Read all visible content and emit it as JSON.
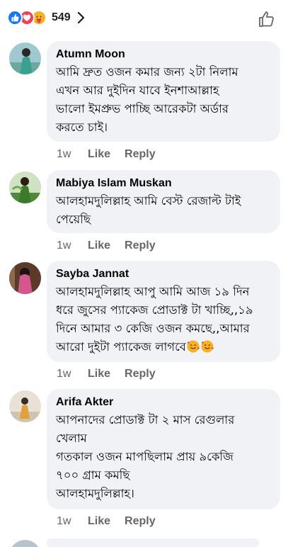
{
  "reactions": {
    "icons": [
      "like-icon",
      "love-icon",
      "care-icon"
    ],
    "count": "549",
    "colors": {
      "like": "#1877f2",
      "love": "#f33e58",
      "care": "#f7b125"
    }
  },
  "comments": [
    {
      "author": "Atumn Moon",
      "text": "আমি দ্রুত ওজন কমার জন্য ২টা নিলাম\nএখন আর দুইদিন যাবে ইনশাআল্লাহ\nভালো ইমপ্রুভ পাচ্ছি আরেকটা অর্ডার\nকরতে চাই।",
      "time": "1w",
      "like_label": "Like",
      "reply_label": "Reply"
    },
    {
      "author": "Mabiya Islam Muskan",
      "text": "আলহামদুলিল্লাহ আমি বেস্ট রেজাল্ট টাই\nপেয়েছি",
      "time": "1w",
      "like_label": "Like",
      "reply_label": "Reply"
    },
    {
      "author": "Sayba Jannat",
      "text": "আলহামদুলিল্লাহ আপু আমি আজ ১৯ দিন\nধরে জুসের প্যাকেজ প্রোডাক্ট টা খাচ্ছি,,১৯\nদিনে আমার ৩ কেজি ওজন কমছে,,আমার\nআরো দুইটা প্যাকেজ লাগবে",
      "emoji": "smiling-face-with-hearts-icon",
      "time": "1w",
      "like_label": "Like",
      "reply_label": "Reply"
    },
    {
      "author": "Arifa Akter",
      "text": "আপনাদের প্রোডাক্ট টা ২ মাস রেগুলার\nখেলাম\nগতকাল ওজন মাপছিলাম প্রায় ৯কেজি\n৭০০ গ্রাম কমছি\nআলহামদুলিল্লাহ।",
      "time": "1w",
      "like_label": "Like",
      "reply_label": "Reply"
    }
  ]
}
